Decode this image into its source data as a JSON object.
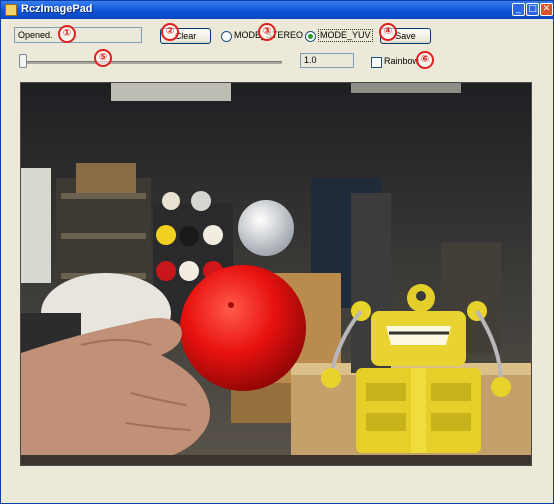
{
  "window": {
    "title": "RczImagePad",
    "min_glyph": "_",
    "max_glyph": "□",
    "close_glyph": "✕"
  },
  "toolbar": {
    "status_text": "Opened.",
    "clear_label": "Clear",
    "radio_stereo_label": "MODE_STEREO",
    "radio_yuv_label": "MODE_YUV",
    "selected_mode": "MODE_YUV",
    "save_label": "Save",
    "slider_value": 1.0,
    "value_text": "1.0",
    "rainbow_label": "Rainbow",
    "rainbow_checked": false
  },
  "markers": [
    "①",
    "②",
    "③",
    "④",
    "⑤",
    "⑥"
  ],
  "colors": {
    "accent_green": "#21a121",
    "marker_red": "#e02020",
    "title_blue": "#0d55d6"
  }
}
